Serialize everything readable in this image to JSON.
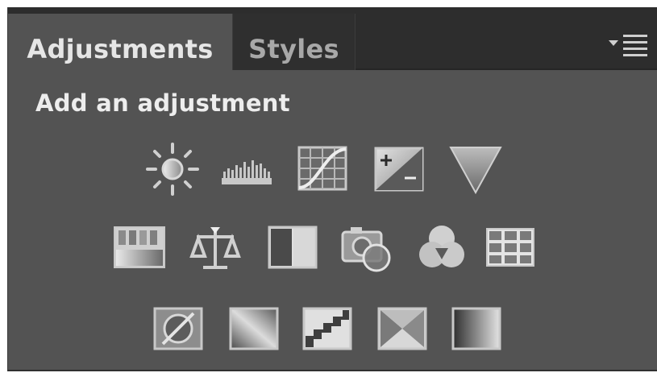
{
  "tabs": [
    {
      "label": "Adjustments",
      "active": true
    },
    {
      "label": "Styles",
      "active": false
    }
  ],
  "panel_menu_icon": "panel-menu-icon",
  "section_title": "Add an adjustment",
  "adjustment_icons": {
    "row1": [
      "brightness-contrast-icon",
      "levels-icon",
      "curves-icon",
      "exposure-icon",
      "vibrance-icon"
    ],
    "row2": [
      "hue-saturation-icon",
      "color-balance-icon",
      "black-white-icon",
      "photo-filter-icon",
      "channel-mixer-icon",
      "color-lookup-icon"
    ],
    "row3": [
      "invert-icon",
      "posterize-icon",
      "threshold-icon",
      "selective-color-icon",
      "gradient-map-icon"
    ]
  },
  "colors": {
    "panel_bg": "#535353",
    "tabbar_bg": "#2d2d2d",
    "active_tab_text": "#e6e6e6",
    "inactive_tab_text": "#a8a8a8",
    "icon_light": "#d2d2d2"
  }
}
